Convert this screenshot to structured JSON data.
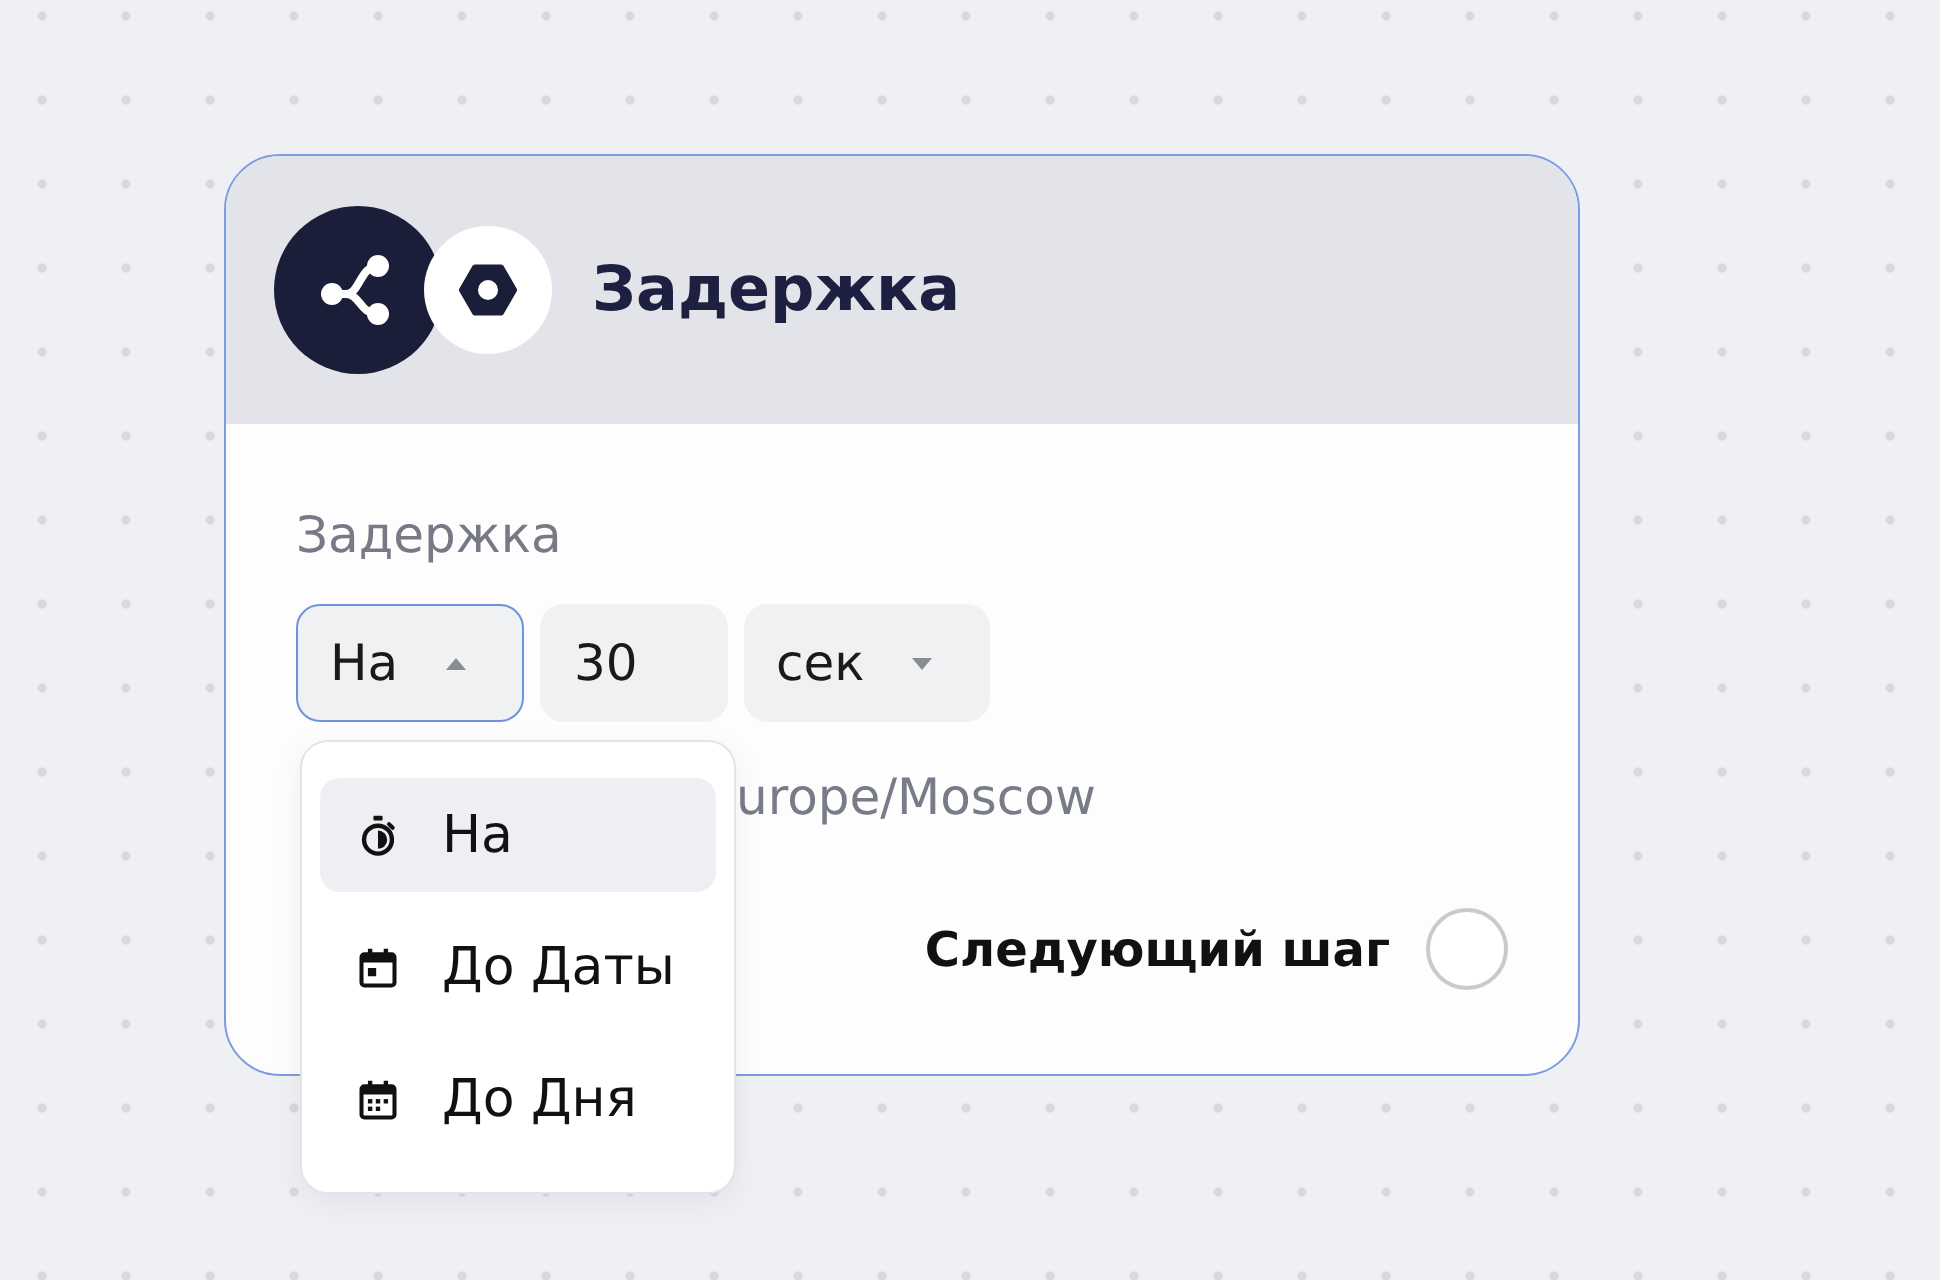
{
  "node": {
    "title": "Задержка"
  },
  "delay": {
    "label": "Задержка",
    "mode_select": {
      "value": "На",
      "expanded": true
    },
    "amount_field": {
      "value": "30"
    },
    "unit_select": {
      "value": "сек",
      "expanded": false
    },
    "timezone": "urope/Moscow"
  },
  "mode_menu": {
    "options": [
      {
        "label": "На",
        "kind": "duration",
        "selected": true
      },
      {
        "label": "До Даты",
        "kind": "date",
        "selected": false
      },
      {
        "label": "До Дня",
        "kind": "day",
        "selected": false
      }
    ]
  },
  "next_step": {
    "label": "Следующий шаг",
    "checked": false
  }
}
